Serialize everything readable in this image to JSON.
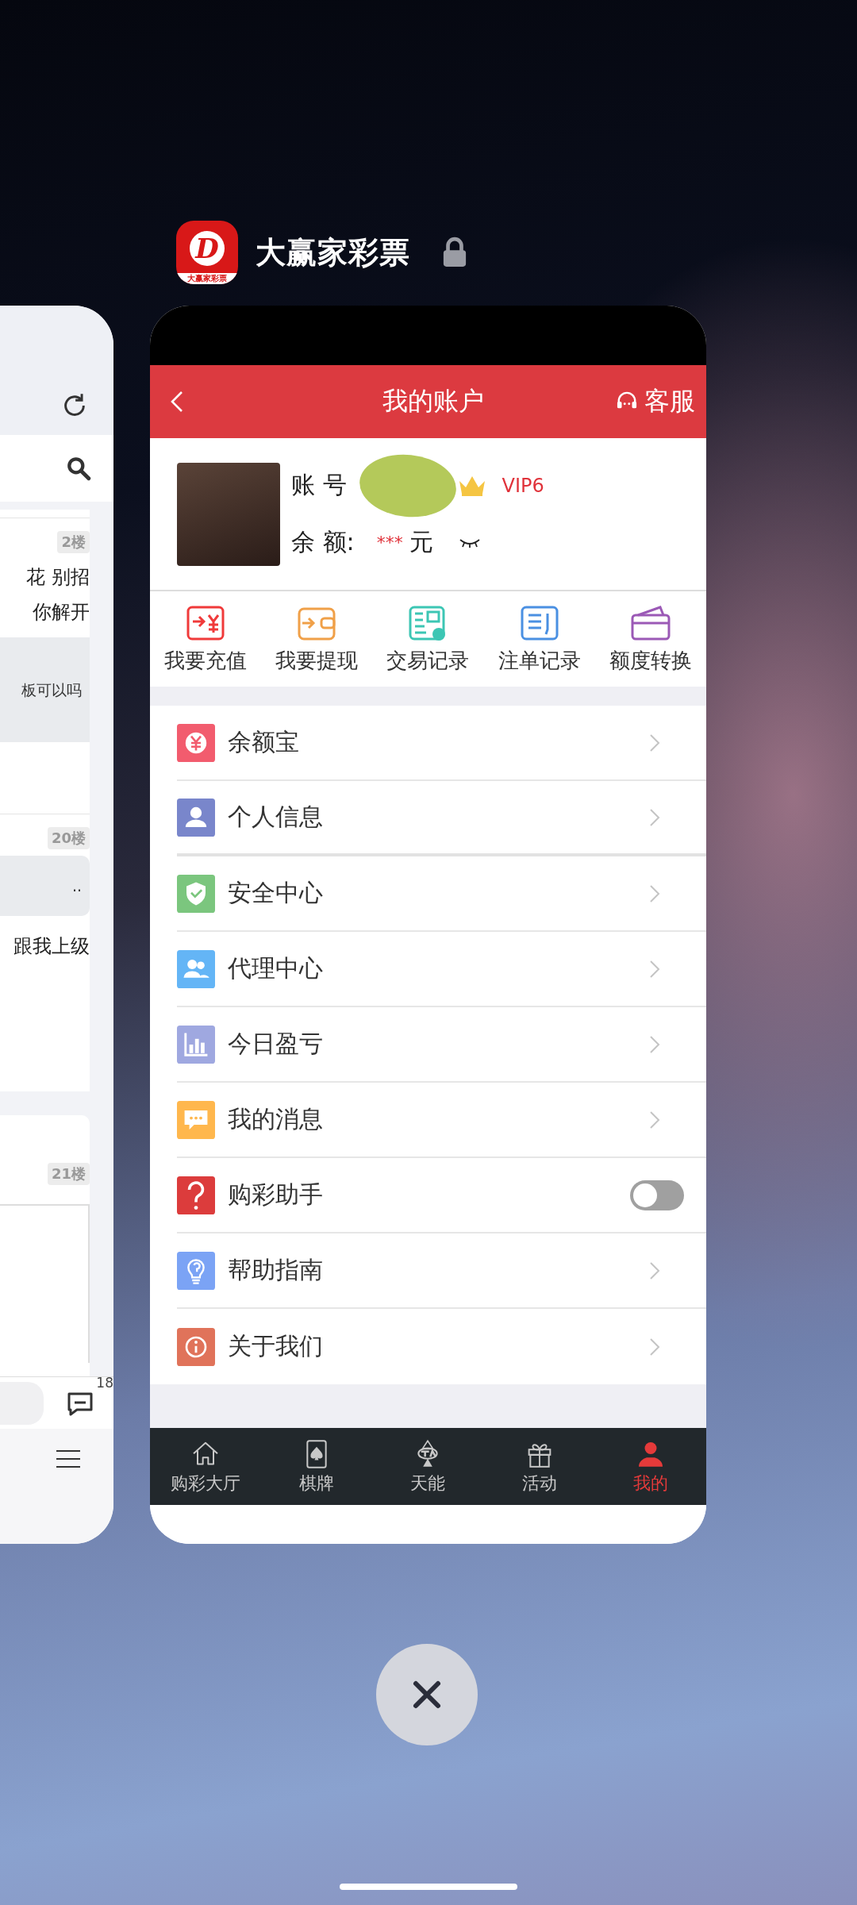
{
  "app_switcher": {
    "app_title": "大赢家彩票",
    "app_icon_letter": "D",
    "app_icon_caption": "大赢家彩票"
  },
  "background_card": {
    "posts": [
      {
        "floor": "2楼",
        "lines": [
          "花 别招",
          "你解开"
        ],
        "quote": "板可以吗"
      },
      {
        "floor": "20楼",
        "quote": "..",
        "lines": [
          "跟我上级"
        ]
      },
      {
        "floor": "21楼"
      }
    ],
    "comment_count": "18"
  },
  "header": {
    "title": "我的账户",
    "service": "客服"
  },
  "profile": {
    "account_label": "账 号",
    "vip": "VIP6",
    "balance_label": "余 额:",
    "balance": "***",
    "currency": "元"
  },
  "quick_actions": [
    {
      "label": "我要充值",
      "color": "#f03a3a"
    },
    {
      "label": "我要提现",
      "color": "#f0a048"
    },
    {
      "label": "交易记录",
      "color": "#3cc6b4"
    },
    {
      "label": "注单记录",
      "color": "#4a90e2"
    },
    {
      "label": "额度转换",
      "color": "#9b59b6"
    }
  ],
  "menu": [
    {
      "label": "余额宝",
      "kind": "link",
      "color": "#f25c6e"
    },
    {
      "label": "个人信息",
      "kind": "link",
      "color": "#7986cb"
    },
    {
      "label": "安全中心",
      "kind": "link",
      "color": "#7bc67e"
    },
    {
      "label": "代理中心",
      "kind": "link",
      "color": "#64b5f6"
    },
    {
      "label": "今日盈亏",
      "kind": "link",
      "color": "#9fa8e0"
    },
    {
      "label": "我的消息",
      "kind": "link",
      "color": "#ffb74d"
    },
    {
      "label": "购彩助手",
      "kind": "toggle",
      "color": "#dc3c3c",
      "on": false
    },
    {
      "label": "帮助指南",
      "kind": "link",
      "color": "#7ba3f5"
    },
    {
      "label": "关于我们",
      "kind": "link",
      "color": "#e0735a"
    }
  ],
  "bottom_nav": [
    {
      "label": "购彩大厅",
      "selected": false
    },
    {
      "label": "棋牌",
      "selected": false
    },
    {
      "label": "天能",
      "selected": false
    },
    {
      "label": "活动",
      "selected": false
    },
    {
      "label": "我的",
      "selected": true
    }
  ]
}
